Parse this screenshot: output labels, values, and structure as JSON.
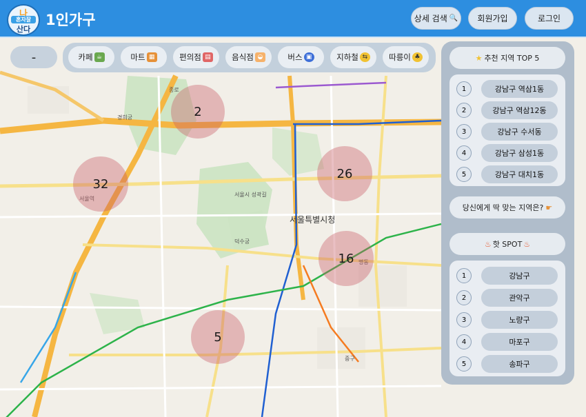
{
  "header": {
    "logo_line1": "나",
    "logo_line2": "혼자잘",
    "logo_line3": "산다",
    "title": "1인가구",
    "detail_search": "상세 검색",
    "signup": "회원가입",
    "login": "로그인"
  },
  "zoom_out_label": "-",
  "categories": [
    {
      "label": "카페",
      "icon": "cafe-icon"
    },
    {
      "label": "마트",
      "icon": "mart-icon"
    },
    {
      "label": "편의점",
      "icon": "convenience-store-icon"
    },
    {
      "label": "음식점",
      "icon": "restaurant-icon"
    },
    {
      "label": "버스",
      "icon": "bus-icon"
    },
    {
      "label": "지하철",
      "icon": "subway-icon"
    },
    {
      "label": "따릉이",
      "icon": "bike-icon"
    }
  ],
  "clusters": [
    "2",
    "32",
    "26",
    "16",
    "5"
  ],
  "panel": {
    "top5_title": "추천 지역  TOP 5",
    "top5": [
      {
        "rank": "1",
        "name": "강남구 역삼1동"
      },
      {
        "rank": "2",
        "name": "강남구 역삼12동"
      },
      {
        "rank": "3",
        "name": "강남구 수서동"
      },
      {
        "rank": "4",
        "name": "강남구 삼성1동"
      },
      {
        "rank": "5",
        "name": "강남구 대치1동"
      }
    ],
    "match_title": "당신에게 딱 맞는 지역은?",
    "hotspot_title": "핫 SPOT",
    "hotspots": [
      {
        "rank": "1",
        "name": "강남구"
      },
      {
        "rank": "2",
        "name": "관악구"
      },
      {
        "rank": "3",
        "name": "노량구"
      },
      {
        "rank": "4",
        "name": "마포구"
      },
      {
        "rank": "5",
        "name": "송파구"
      }
    ]
  },
  "map_labels": {
    "city_hall": "서울특별시청",
    "fortress": "서울시 성곽길",
    "station_seoul": "서울역",
    "jongno": "종로",
    "kyunghee": "경희궁",
    "deoksu": "덕수궁",
    "jung_gu": "중구",
    "myeongdong": "명동"
  }
}
